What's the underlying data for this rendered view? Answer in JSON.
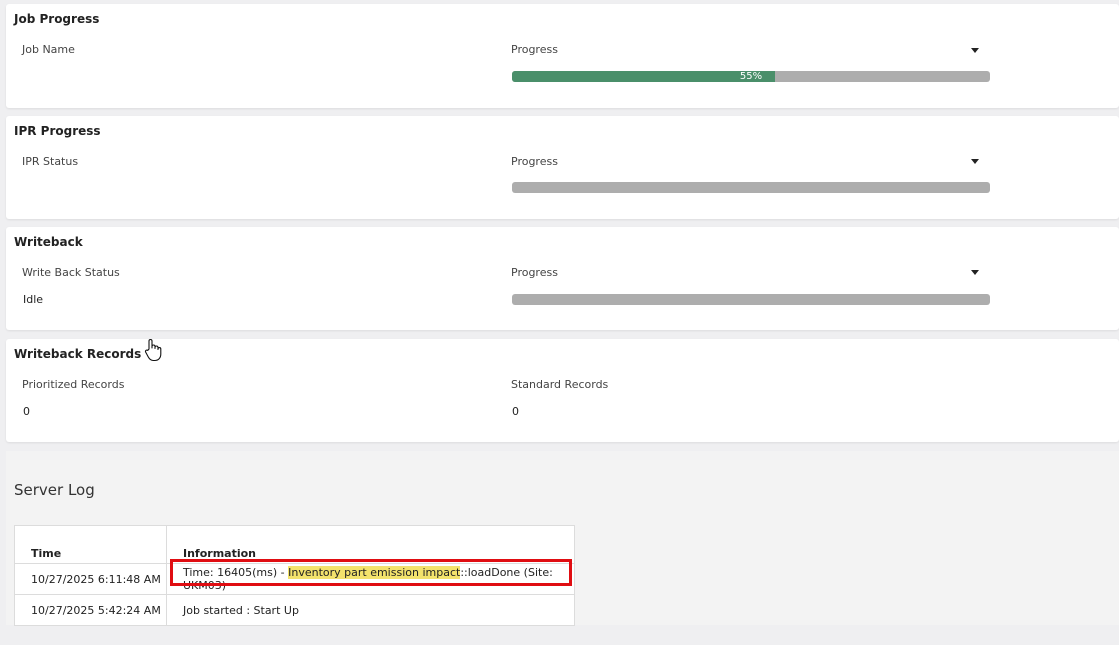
{
  "job_progress": {
    "title": "Job Progress",
    "name_label": "Job Name",
    "progress_label": "Progress",
    "progress_percent": 55,
    "progress_text": "55%"
  },
  "ipr_progress": {
    "title": "IPR Progress",
    "status_label": "IPR Status",
    "progress_label": "Progress",
    "progress_percent": 0
  },
  "writeback": {
    "title": "Writeback",
    "status_label": "Write Back Status",
    "status_value": "Idle",
    "progress_label": "Progress",
    "progress_percent": 0
  },
  "writeback_records": {
    "title": "Writeback Records",
    "prioritized_label": "Prioritized Records",
    "prioritized_value": "0",
    "standard_label": "Standard Records",
    "standard_value": "0"
  },
  "server_log": {
    "title": "Server Log",
    "columns": [
      "Time",
      "Information"
    ],
    "rows": [
      {
        "time": "10/27/2025 6:11:48 AM",
        "info_prefix": "Time: 16405(ms) - ",
        "info_highlight": "Inventory part emission impact",
        "info_suffix": "::loadDone (Site: UKM03)"
      },
      {
        "time": "10/27/2025 5:42:24 AM",
        "info": "Job started : Start Up"
      }
    ]
  },
  "colors": {
    "progress_fill": "#4a8f6a",
    "progress_track": "#adadad",
    "highlight": "#f3e36c",
    "annotation_box": "#e00d12"
  }
}
